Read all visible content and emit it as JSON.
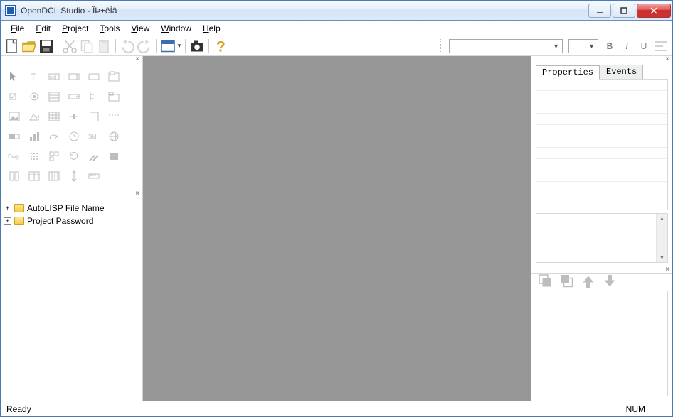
{
  "window": {
    "title": "OpenDCL Studio - ÎÞ±êÌâ"
  },
  "menus": {
    "file": "File",
    "edit": "Edit",
    "project": "Project",
    "tools": "Tools",
    "view": "View",
    "window": "Window",
    "help": "Help"
  },
  "formatting": {
    "font_value": "",
    "size_value": "",
    "bold": "B",
    "italic": "I",
    "underline": "U"
  },
  "tree": {
    "items": [
      {
        "label": "AutoLISP File Name"
      },
      {
        "label": "Project Password"
      }
    ]
  },
  "props": {
    "tab_properties": "Properties",
    "tab_events": "Events"
  },
  "status": {
    "left": "Ready",
    "num": "NUM"
  }
}
